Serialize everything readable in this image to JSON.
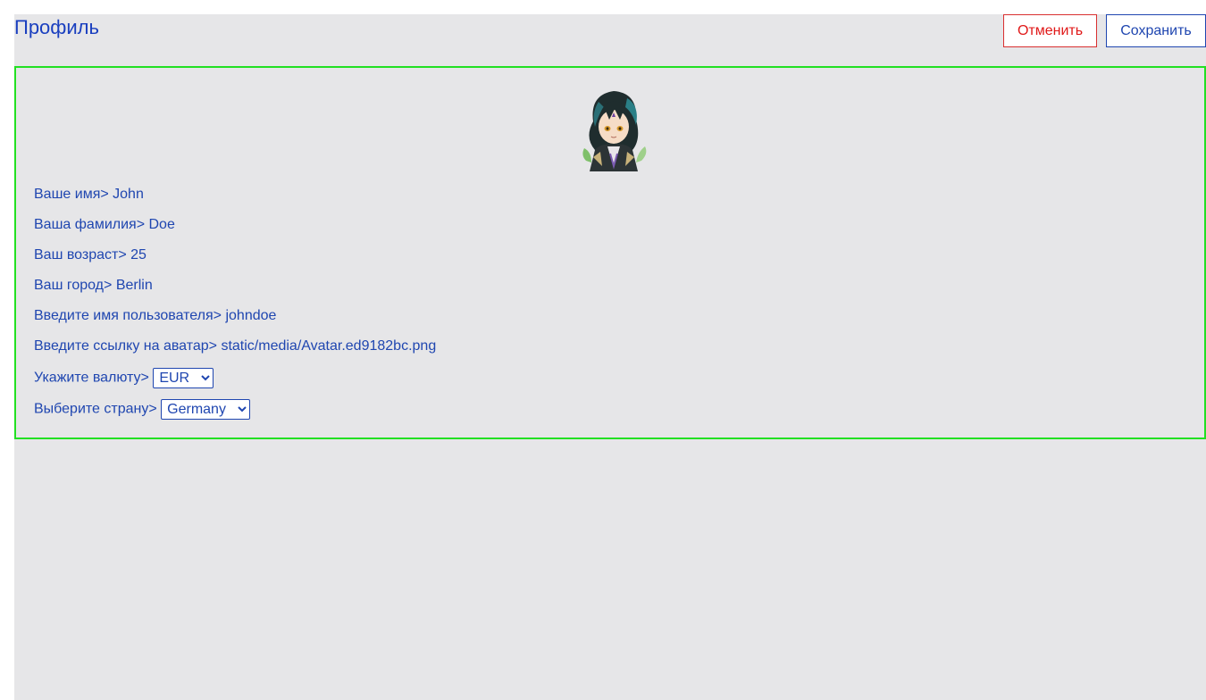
{
  "header": {
    "title": "Профиль",
    "cancel_label": "Отменить",
    "save_label": "Сохранить"
  },
  "profile": {
    "avatar_icon": "anime-character-avatar-icon",
    "fields": [
      {
        "label": "Ваше имя> ",
        "value": "John"
      },
      {
        "label": "Ваша фамилия> ",
        "value": "Doe"
      },
      {
        "label": "Ваш возраст> ",
        "value": "25"
      },
      {
        "label": "Ваш город> ",
        "value": "Berlin"
      },
      {
        "label": "Введите имя пользователя> ",
        "value": "johndoe"
      },
      {
        "label": "Введите ссылку на аватар> ",
        "value": "static/media/Avatar.ed9182bc.png"
      }
    ],
    "currency": {
      "label": "Укажите валюту> ",
      "selected": "EUR"
    },
    "country": {
      "label": "Выберите страну> ",
      "selected": "Germany"
    }
  },
  "colors": {
    "accent": "#1f46b0",
    "cancel": "#e01818",
    "card_border": "#22e022",
    "background": "#e6e6e8"
  }
}
